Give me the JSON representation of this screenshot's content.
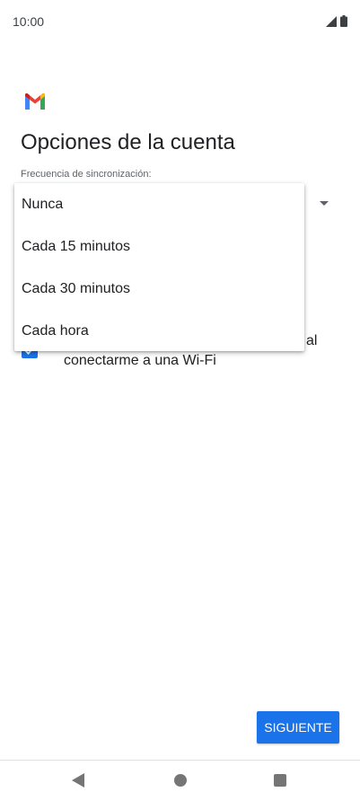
{
  "status_bar": {
    "time": "10:00",
    "icons": [
      "signal-icon",
      "battery-icon"
    ]
  },
  "app": {
    "logo": "gmail-logo"
  },
  "page": {
    "title": "Opciones de la cuenta",
    "sync_frequency_label": "Frecuencia de sincronización:"
  },
  "sync_dropdown": {
    "options": [
      {
        "label": "Nunca"
      },
      {
        "label": "Cada 15 minutos"
      },
      {
        "label": "Cada 30 minutos"
      },
      {
        "label": "Cada hora"
      }
    ]
  },
  "wifi_option": {
    "checked": true,
    "text_tail": "al",
    "text_line2": "conectarme a una Wi-Fi"
  },
  "buttons": {
    "next": "SIGUIENTE"
  },
  "nav_bar": {
    "icons": [
      "back-icon",
      "home-icon",
      "recents-icon"
    ]
  },
  "colors": {
    "accent": "#1a73e8",
    "gmail_red": "#ea4335",
    "gmail_blue": "#4285f4",
    "gmail_green": "#34a853",
    "gmail_yellow": "#fbbc04"
  }
}
